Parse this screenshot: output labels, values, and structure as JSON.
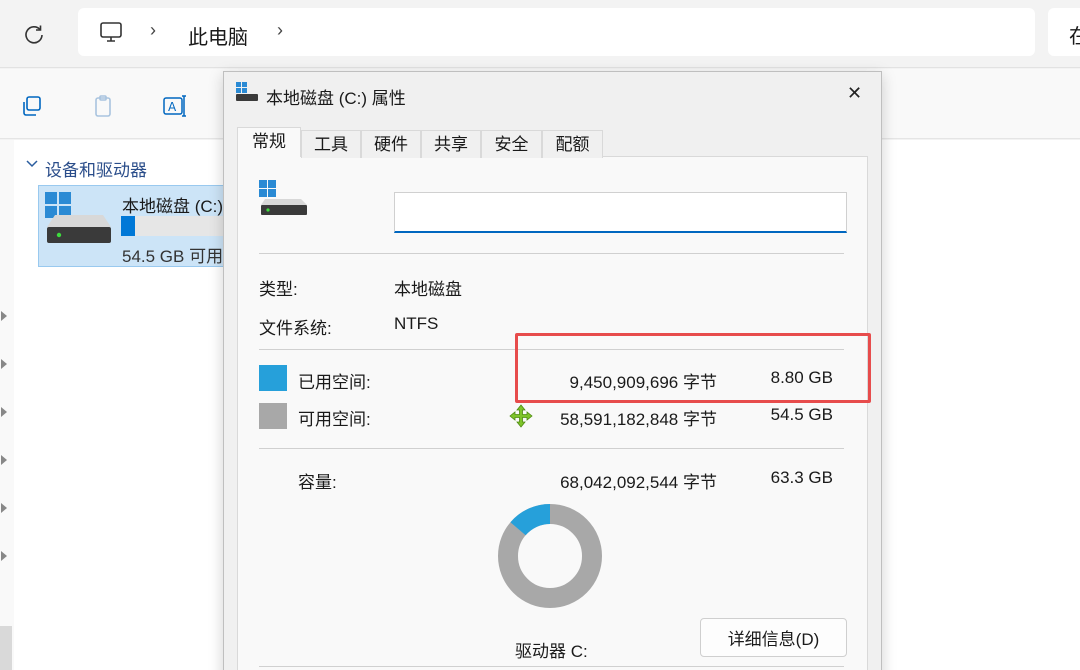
{
  "address": {
    "refresh_icon": "refresh-icon",
    "pc_icon": "monitor-icon",
    "crumb_sep": "›",
    "location": "此电脑",
    "search_text": "在"
  },
  "toolbar": {
    "icons": [
      "copy-icon",
      "paste-icon",
      "rename-icon"
    ]
  },
  "sidebar": {
    "group_label": "设备和驱动器"
  },
  "drive_tile": {
    "name": "本地磁盘 (C:)",
    "free_text": "54.5 GB 可用",
    "used_fraction": 0.139
  },
  "dialog": {
    "title": "本地磁盘 (C:) 属性",
    "close_glyph": "✕",
    "tabs": [
      {
        "label": "常规",
        "active": true
      },
      {
        "label": "工具",
        "active": false
      },
      {
        "label": "硬件",
        "active": false
      },
      {
        "label": "共享",
        "active": false
      },
      {
        "label": "安全",
        "active": false
      },
      {
        "label": "配额",
        "active": false
      }
    ],
    "name_value": "",
    "type_label": "类型:",
    "type_value": "本地磁盘",
    "fs_label": "文件系统:",
    "fs_value": "NTFS",
    "used": {
      "label": "已用空间:",
      "bytes": "9,450,909,696 字节",
      "size": "8.80 GB"
    },
    "free": {
      "label": "可用空间:",
      "bytes": "58,591,182,848 字节",
      "size": "54.5 GB"
    },
    "capacity": {
      "label": "容量:",
      "bytes": "68,042,092,544 字节",
      "size": "63.3 GB"
    },
    "drive_label": "驱动器 C:",
    "details_button": "详细信息(D)",
    "used_fraction": 0.139,
    "colors": {
      "used": "#26a0da",
      "free": "#a8a8a8",
      "highlight": "#e74c4c"
    }
  }
}
